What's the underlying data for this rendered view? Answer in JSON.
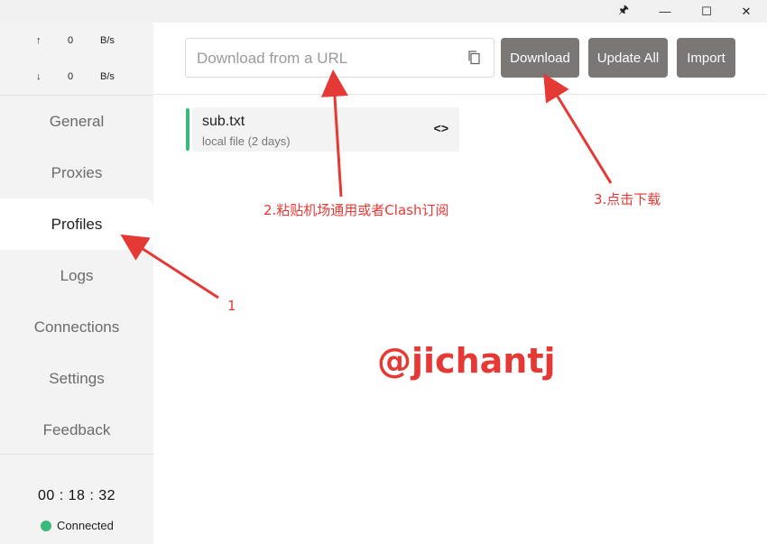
{
  "titlebar": {
    "pin_glyph": "🖈",
    "minimize_glyph": "—",
    "maximize_glyph": "☐",
    "close_glyph": "✕"
  },
  "traffic": {
    "up": {
      "arrow": "↑",
      "value": "0",
      "unit": "B/s"
    },
    "down": {
      "arrow": "↓",
      "value": "0",
      "unit": "B/s"
    }
  },
  "sidebar": {
    "items": [
      {
        "label": "General"
      },
      {
        "label": "Proxies"
      },
      {
        "label": "Profiles"
      },
      {
        "label": "Logs"
      },
      {
        "label": "Connections"
      },
      {
        "label": "Settings"
      },
      {
        "label": "Feedback"
      }
    ],
    "active": "Profiles",
    "clock": "00 : 18 : 32",
    "status": "Connected"
  },
  "header": {
    "url_placeholder": "Download from a URL",
    "url_value": "",
    "download_label": "Download",
    "update_all_label": "Update All",
    "import_label": "Import"
  },
  "profiles": [
    {
      "name": "sub.txt",
      "subtitle": "local file (2 days)",
      "action_glyph": "<>"
    }
  ],
  "annotations": {
    "label_1": "1",
    "label_2": "2.粘贴机场通用或者Clash订阅",
    "label_3": "3.点击下载",
    "watermark": "@jichantj"
  },
  "colors": {
    "accent_green": "#3bb97b",
    "button_bg": "#7b7774",
    "annotation_red": "#e53935",
    "sidebar_bg": "#f3f3f3"
  }
}
